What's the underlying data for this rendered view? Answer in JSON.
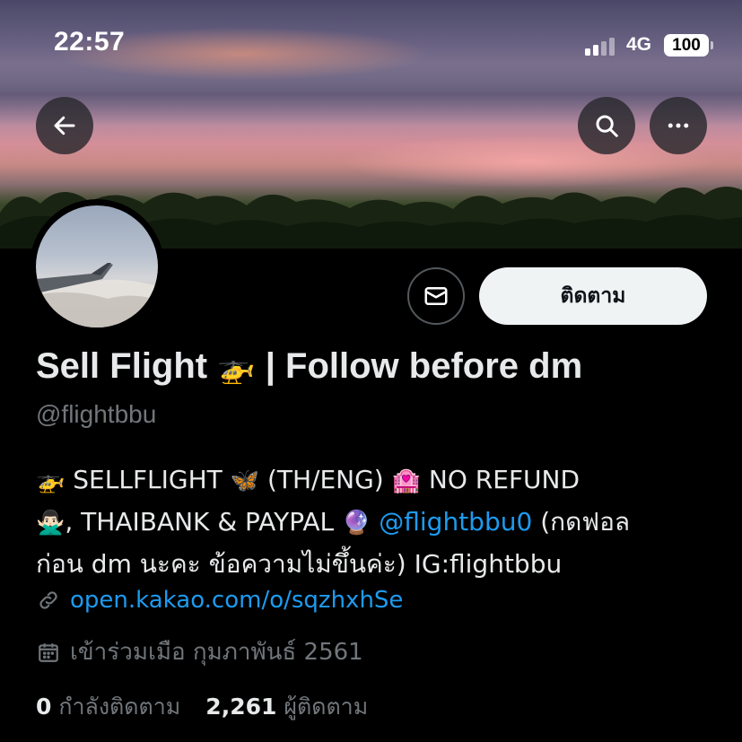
{
  "status_bar": {
    "time": "22:57",
    "network": "4G",
    "battery": "100"
  },
  "header": {
    "back_icon": "arrow-left-icon",
    "search_icon": "search-icon",
    "more_icon": "more-horizontal-icon"
  },
  "profile": {
    "display_name": "Sell Flight",
    "display_name_emoji": "🚁",
    "display_name_suffix": "| Follow before dm",
    "handle": "@flightbbu",
    "follow_label": "ติดตาม",
    "message_icon": "mail-icon"
  },
  "bio": {
    "line1_emoji1": "🚁",
    "line1_text1": "SELLFLIGHT",
    "line1_emoji2": "🦋",
    "line1_text2": "(TH/ENG)",
    "line1_emoji3": "🏩",
    "line1_text3": "NO REFUND",
    "line2_emoji1": "🙅🏻‍♂️",
    "line2_text1": ", THAIBANK & PAYPAL",
    "line2_emoji2": "🔮",
    "mention": "@flightbbu0",
    "line2_text2": "(กดฟอล",
    "line3_text": "ก่อน dm นะคะ ข้อความไม่ขึ้นค่ะ) IG:flightbbu"
  },
  "meta": {
    "link_icon": "link-icon",
    "link_text": "open.kakao.com/o/sqzhxhSe",
    "calendar_icon": "calendar-icon",
    "joined_text": "เข้าร่วมเมือ กุมภาพันธ์ 2561"
  },
  "stats": {
    "following_count": "0",
    "following_label": "กำลังติดตาม",
    "followers_count": "2,261",
    "followers_label": "ผู้ติดตาม"
  },
  "colors": {
    "background": "#000000",
    "text_primary": "#e7e9ea",
    "text_secondary": "#71767b",
    "link": "#1d9bf0",
    "follow_button_bg": "#eff3f4"
  }
}
